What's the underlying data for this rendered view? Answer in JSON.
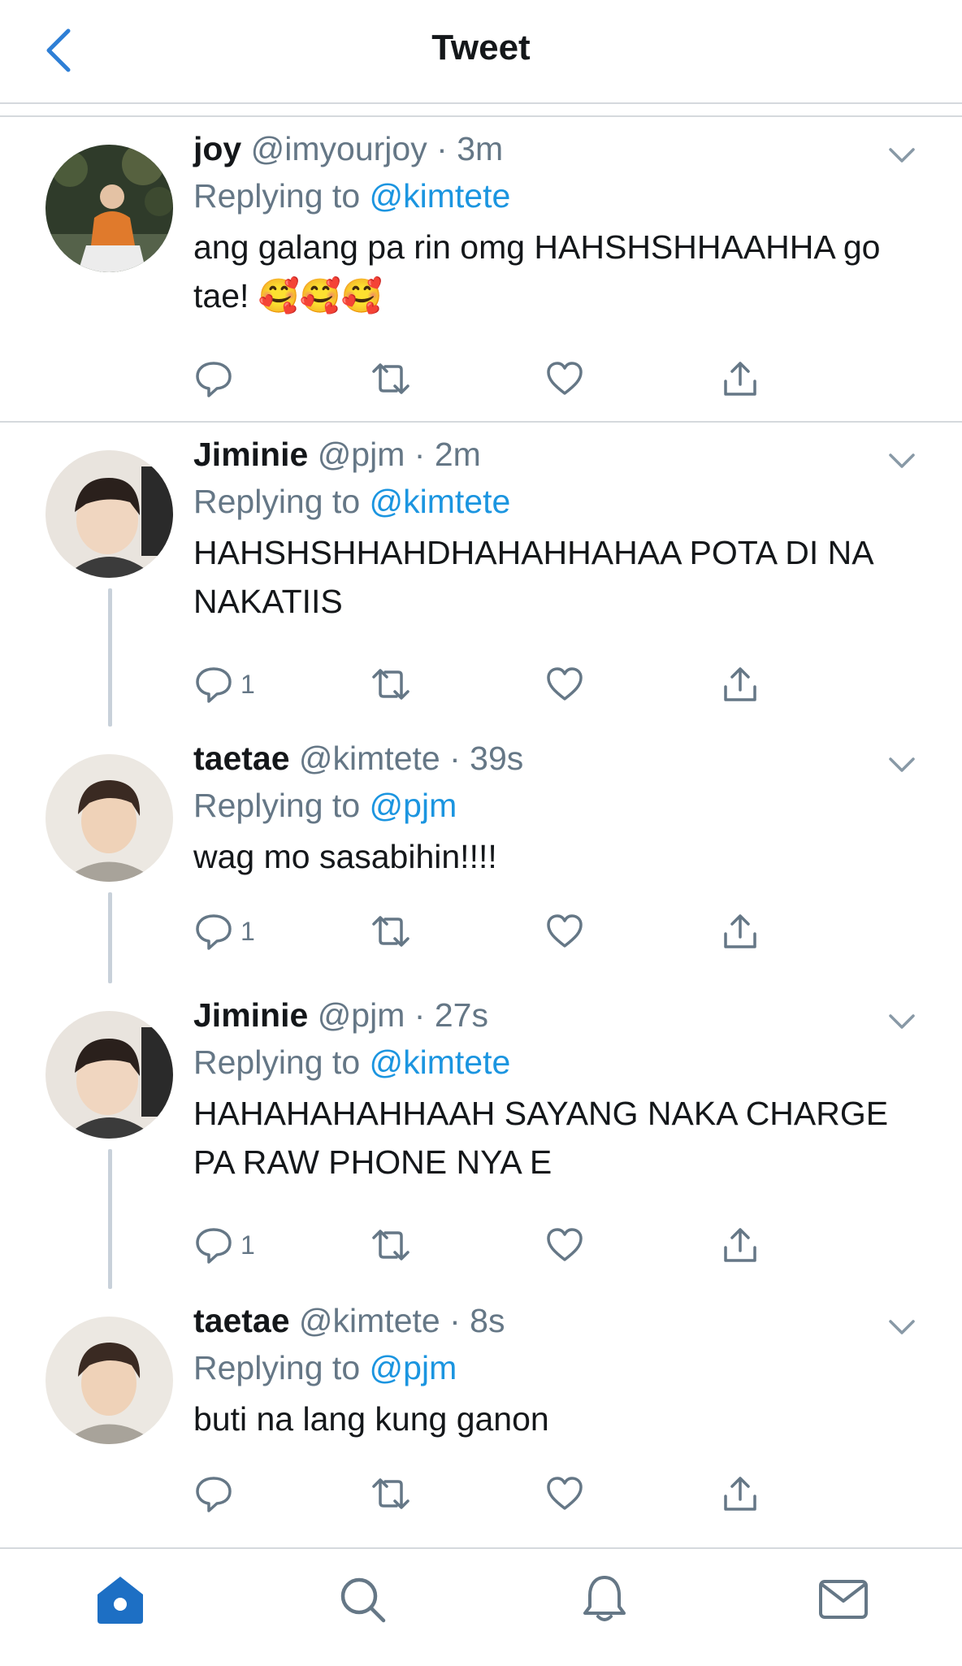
{
  "header": {
    "title": "Tweet"
  },
  "tweets": [
    {
      "name": "joy",
      "handle": "@imyourjoy",
      "sep": "·",
      "time": "3m",
      "replying_label": "Replying to",
      "replying_to": "@kimtete",
      "text": "ang galang pa rin omg HAHSHSHHAAHHA go tae! 🥰🥰🥰",
      "reply_count": ""
    },
    {
      "name": "Jiminie",
      "handle": "@pjm",
      "sep": "·",
      "time": "2m",
      "replying_label": "Replying to",
      "replying_to": "@kimtete",
      "text": "HAHSHSHHAHDHAHAHHAHAA POTA DI NA NAKATIIS",
      "reply_count": "1"
    },
    {
      "name": "taetae",
      "handle": "@kimtete",
      "sep": "·",
      "time": "39s",
      "replying_label": "Replying to",
      "replying_to": "@pjm",
      "text": "wag mo sasabihin!!!!",
      "reply_count": "1"
    },
    {
      "name": "Jiminie",
      "handle": "@pjm",
      "sep": "·",
      "time": "27s",
      "replying_label": "Replying to",
      "replying_to": "@kimtete",
      "text": "HAHAHAHAHHAAH SAYANG NAKA CHARGE PA RAW PHONE NYA E",
      "reply_count": "1"
    },
    {
      "name": "taetae",
      "handle": "@kimtete",
      "sep": "·",
      "time": "8s",
      "replying_label": "Replying to",
      "replying_to": "@pjm",
      "text": "buti na lang kung ganon",
      "reply_count": ""
    }
  ],
  "tabs": [
    "home-icon",
    "search-icon",
    "notifications-icon",
    "messages-icon"
  ],
  "colors": {
    "accent": "#1b95e0",
    "muted": "#657786",
    "text": "#14171a",
    "divider": "#d5d9dd",
    "tab_active": "#1d6fc4"
  }
}
